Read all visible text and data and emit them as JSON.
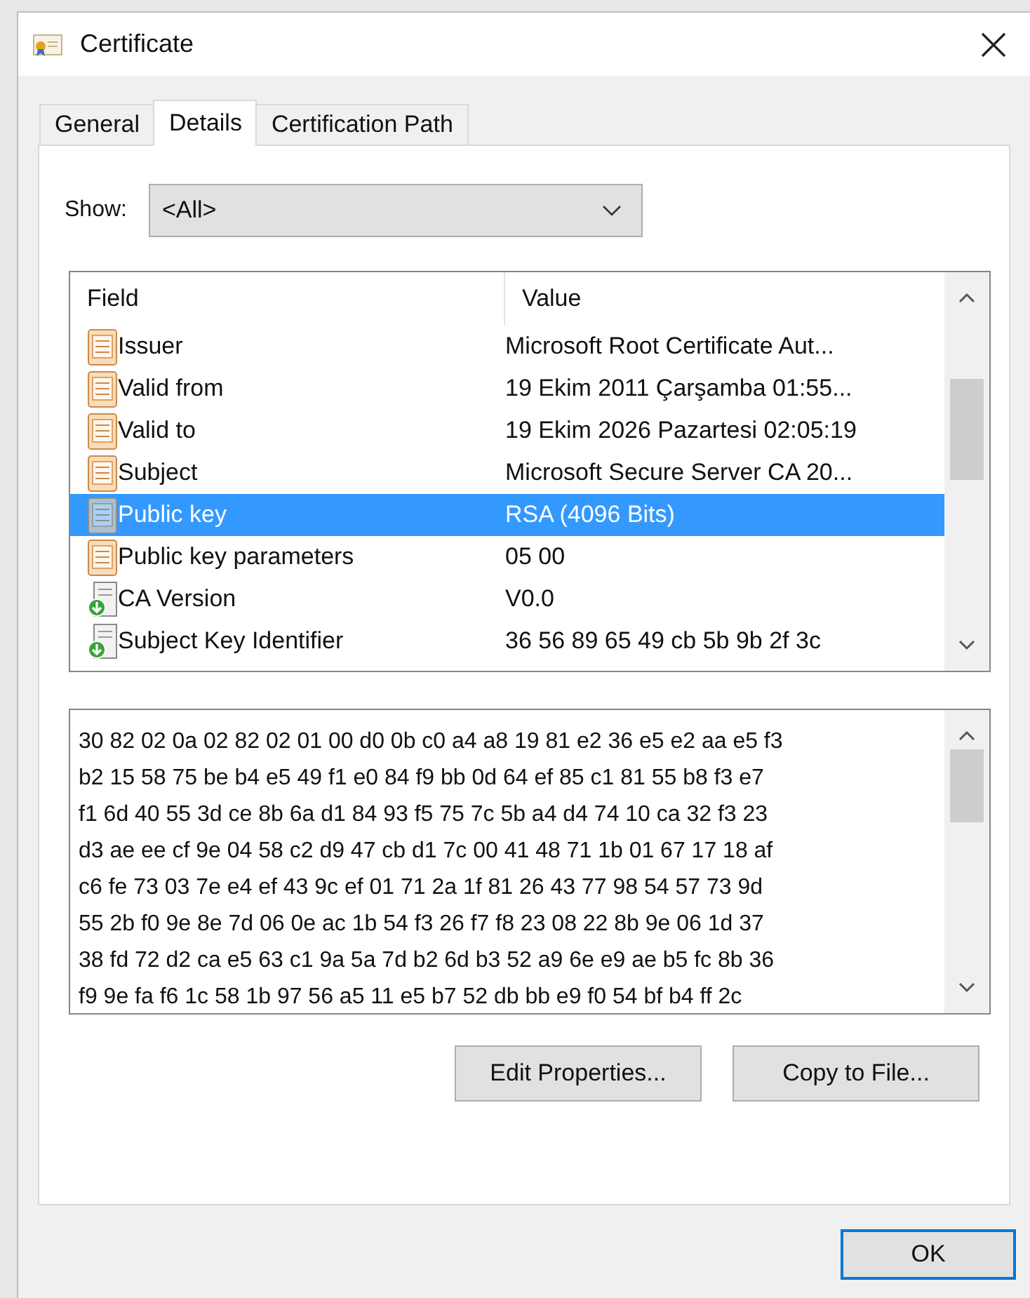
{
  "window": {
    "title": "Certificate"
  },
  "tabs": [
    {
      "label": "General",
      "selected": false
    },
    {
      "label": "Details",
      "selected": true
    },
    {
      "label": "Certification Path",
      "selected": false
    }
  ],
  "show": {
    "label": "Show:",
    "value": "<All>"
  },
  "fields_list": {
    "columns": [
      "Field",
      "Value"
    ],
    "rows": [
      {
        "kind": "field",
        "field": "Issuer",
        "value": "Microsoft Root Certificate Aut...",
        "selected": false
      },
      {
        "kind": "field",
        "field": "Valid from",
        "value": "19 Ekim 2011 Çarşamba 01:55...",
        "selected": false
      },
      {
        "kind": "field",
        "field": "Valid to",
        "value": "19 Ekim 2026 Pazartesi 02:05:19",
        "selected": false
      },
      {
        "kind": "field",
        "field": "Subject",
        "value": "Microsoft Secure Server CA 20...",
        "selected": false
      },
      {
        "kind": "field",
        "field": "Public key",
        "value": "RSA (4096 Bits)",
        "selected": true
      },
      {
        "kind": "field",
        "field": "Public key parameters",
        "value": "05 00",
        "selected": false
      },
      {
        "kind": "extension",
        "field": "CA Version",
        "value": "V0.0",
        "selected": false
      },
      {
        "kind": "extension",
        "field": "Subject Key Identifier",
        "value": "36 56 89 65 49 cb 5b 9b 2f 3c",
        "selected": false
      }
    ]
  },
  "value_detail": [
    "30 82 02 0a 02 82 02 01 00 d0 0b c0 a4 a8 19 81 e2 36 e5 e2 aa e5 f3",
    "b2 15 58 75 be b4 e5 49 f1 e0 84 f9 bb 0d 64 ef 85 c1 81 55 b8 f3 e7",
    "f1 6d 40 55 3d ce 8b 6a d1 84 93 f5 75 7c 5b a4 d4 74 10 ca 32 f3 23",
    "d3 ae ee cf 9e 04 58 c2 d9 47 cb d1 7c 00 41 48 71 1b 01 67 17 18 af",
    "c6 fe 73 03 7e e4 ef 43 9c ef 01 71 2a 1f 81 26 43 77 98 54 57 73 9d",
    "55 2b f0 9e 8e 7d 06 0e ac 1b 54 f3 26 f7 f8 23 08 22 8b 9e 06 1d 37",
    "38 fd 72 d2 ca e5 63 c1 9a 5a 7d b2 6d b3 52 a9 6e e9 ae b5 fc 8b 36",
    "f9 9e fa f6 1c 58 1b 97 56 a5 11 e5 b7 52 db bb e9 f0 54 bf b4 ff 2c"
  ],
  "buttons": [
    "Edit Properties...",
    "Copy to File..."
  ],
  "ok_button": "OK"
}
